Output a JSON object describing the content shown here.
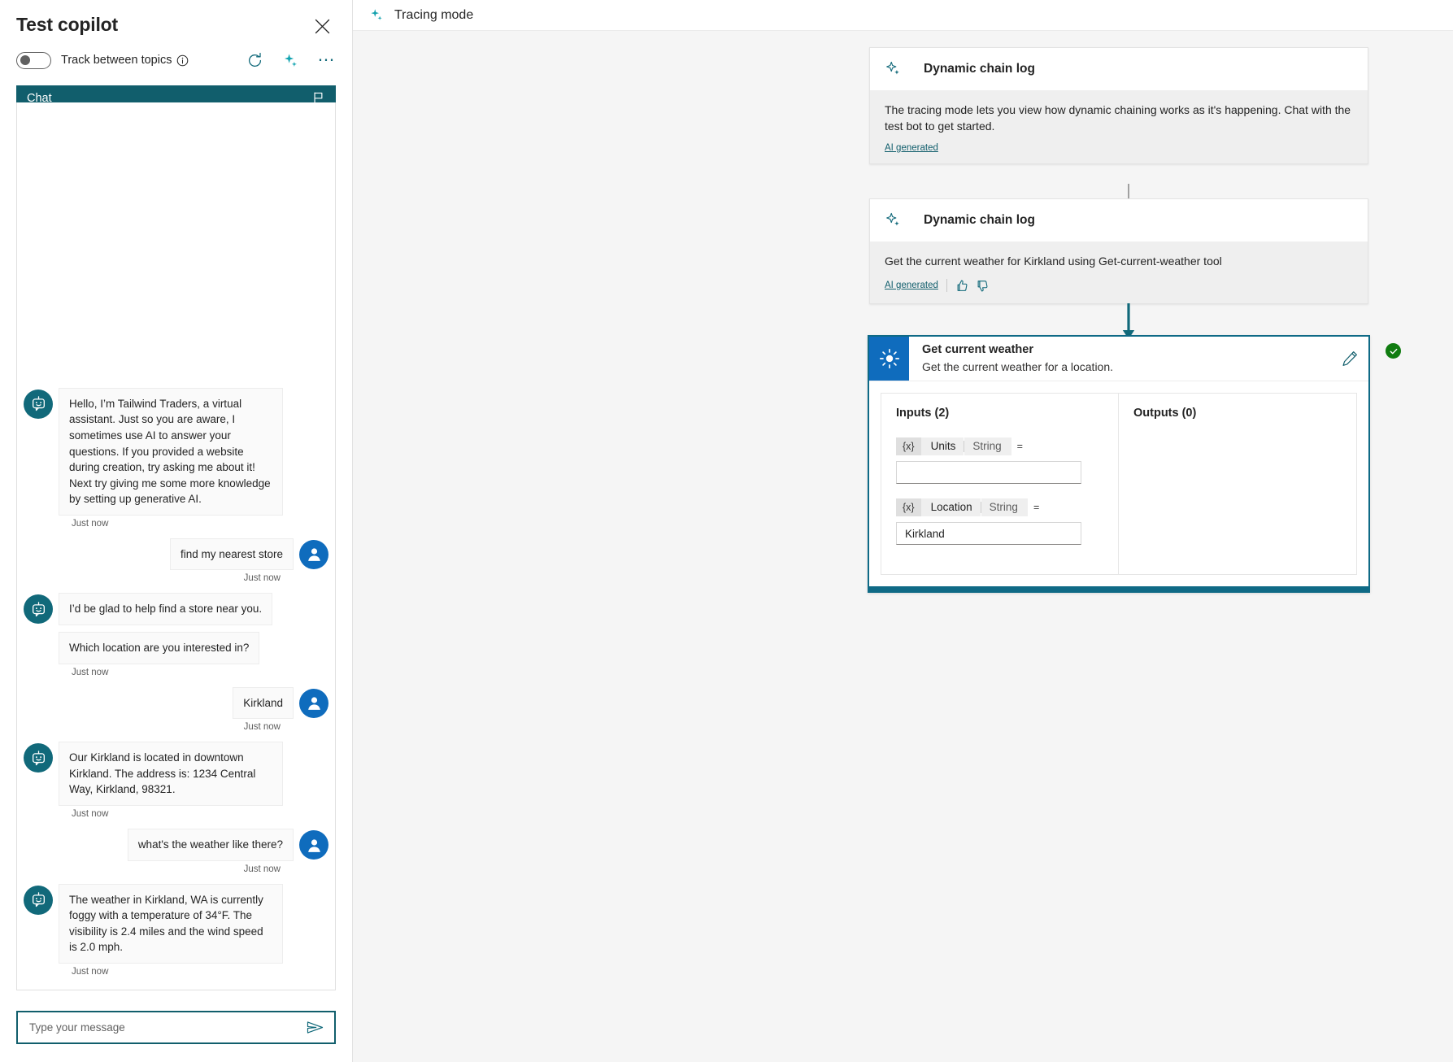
{
  "left_panel": {
    "title": "Test copilot",
    "close_icon": "close-icon",
    "toggle": {
      "label": "Track between topics",
      "state": "off",
      "info_icon": "info-icon"
    },
    "toolbar": {
      "refresh_icon": "refresh-icon",
      "sparkle_icon": "sparkle-icon",
      "more_icon": "more-options-icon"
    },
    "chat_tab": {
      "label": "Chat",
      "flag_icon": "flag-icon"
    },
    "messages": [
      {
        "sender": "bot",
        "bubbles": [
          "Hello, I’m Tailwind Traders, a virtual assistant. Just so you are aware, I sometimes use AI to answer your questions. If you provided a website during creation, try asking me about it! Next try giving me some more knowledge by setting up generative AI."
        ],
        "timestamp": "Just now"
      },
      {
        "sender": "user",
        "bubbles": [
          "find my nearest store"
        ],
        "timestamp": "Just now"
      },
      {
        "sender": "bot",
        "bubbles": [
          "I’d be glad to help find a store near you.",
          "Which location are you interested in?"
        ],
        "timestamp": "Just now"
      },
      {
        "sender": "user",
        "bubbles": [
          "Kirkland"
        ],
        "timestamp": "Just now"
      },
      {
        "sender": "bot",
        "bubbles": [
          "Our Kirkland is located in downtown Kirkland. The address is: 1234 Central Way, Kirkland, 98321."
        ],
        "timestamp": "Just now"
      },
      {
        "sender": "user",
        "bubbles": [
          "what's the weather like there?"
        ],
        "timestamp": "Just now"
      },
      {
        "sender": "bot",
        "bubbles": [
          "The weather in Kirkland, WA is currently foggy with a temperature of 34°F. The visibility is 2.4 miles and the wind speed is 2.0 mph."
        ],
        "timestamp": "Just now"
      }
    ],
    "composer": {
      "placeholder": "Type your message",
      "value": "",
      "send_icon": "send-icon"
    }
  },
  "right_panel": {
    "header": {
      "title": "Tracing mode",
      "sparkle_icon": "sparkle-icon"
    },
    "cards": [
      {
        "title": "Dynamic chain log",
        "icon": "sparkle-icon",
        "text": "The tracing mode lets you view how dynamic chaining works as it's happening. Chat with the test bot to get started.",
        "ai_label": "AI generated",
        "has_feedback": false
      },
      {
        "title": "Dynamic chain log",
        "icon": "sparkle-icon",
        "text": "Get the current weather for Kirkland using Get-current-weather tool",
        "ai_label": "AI generated",
        "has_feedback": true,
        "thumbs_up_icon": "thumbs-up-icon",
        "thumbs_down_icon": "thumbs-down-icon"
      }
    ],
    "node": {
      "icon": "weather-sun-icon",
      "title": "Get current weather",
      "subtitle": "Get the current weather for a location.",
      "edit_icon": "edit-pencil-icon",
      "status_icon": "success-check-icon",
      "inputs_heading": "Inputs (2)",
      "outputs_heading": "Outputs (0)",
      "inputs": [
        {
          "var_icon": "{x}",
          "name": "Units",
          "type": "String",
          "equals": "=",
          "value": "",
          "focused": true
        },
        {
          "var_icon": "{x}",
          "name": "Location",
          "type": "String",
          "equals": "=",
          "value": "Kirkland",
          "focused": false
        }
      ],
      "outputs": []
    }
  },
  "colors": {
    "teal_accent": "#115E6C",
    "blue_accent": "#0f6cbd",
    "node_border": "#0f6a86",
    "success_green": "#107c10",
    "canvas_bg": "#f5f5f5",
    "card_body_bg": "#efefef"
  }
}
